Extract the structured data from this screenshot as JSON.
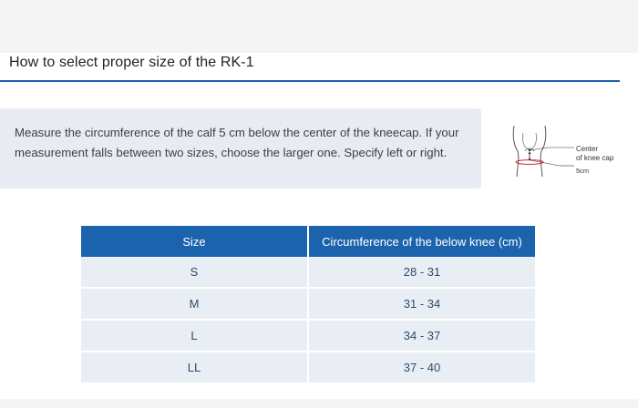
{
  "page": {
    "title": "How to select proper size of the RK-1",
    "instructions_line1": "Measure the circumference of the calf 5 cm below the center of the kneecap. If your",
    "instructions_line2": "measurement falls between two sizes, choose the larger one. Specify left or right."
  },
  "diagram": {
    "label_line1": "Center",
    "label_line2": "of knee cap",
    "label_distance": "5cm",
    "icon": "knee-measurement-diagram"
  },
  "size_table": {
    "headers": [
      "Size",
      "Circumference of the below knee (cm)"
    ],
    "rows": [
      {
        "size": "S",
        "range": "28 - 31"
      },
      {
        "size": "M",
        "range": "31 - 34"
      },
      {
        "size": "L",
        "range": "34 - 37"
      },
      {
        "size": "LL",
        "range": "37 - 40"
      }
    ]
  },
  "colors": {
    "accent_blue": "#1c63ad",
    "rule_blue": "#1f5fa9",
    "note_bg": "#e8ecf2",
    "row_bg": "#e9eef5",
    "measure_red": "#cc2a2a"
  }
}
